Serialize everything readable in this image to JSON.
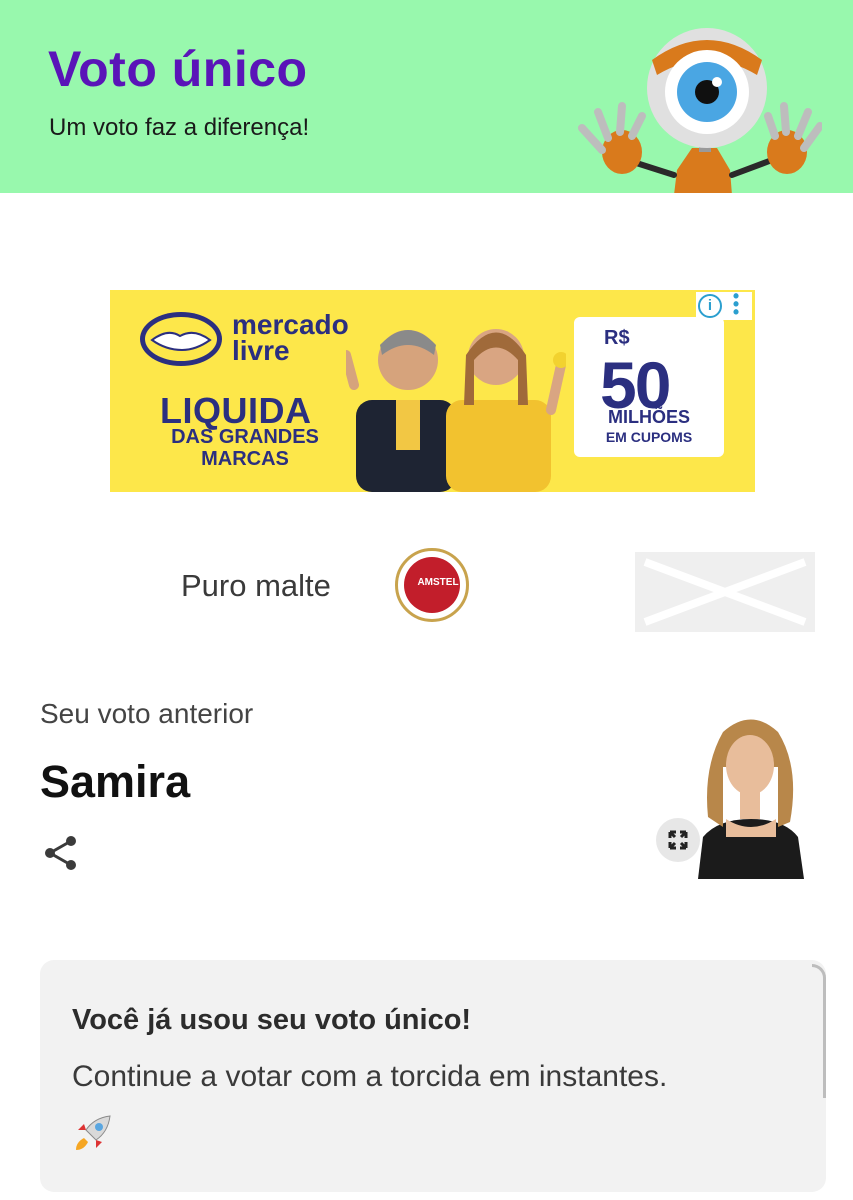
{
  "header": {
    "title": "Voto único",
    "subtitle": "Um voto faz a diferença!"
  },
  "ad": {
    "brand": "mercado livre",
    "headline": "LIQUIDA",
    "subheadline": "DAS GRANDES MARCAS",
    "currency": "R$",
    "amount": "50",
    "unit": "MILHÕES",
    "caption": "EM CUPOMS"
  },
  "sponsor": {
    "text": "Puro malte",
    "logo_text": "AMSTEL"
  },
  "previous_vote": {
    "label": "Seu voto anterior",
    "name": "Samira"
  },
  "notice": {
    "title": "Você já usou seu voto único!",
    "body": "Continue a votar com a torcida em instantes.",
    "emoji": "rocket-icon"
  },
  "colors": {
    "header_bg": "#98f8ad",
    "title": "#5a14b8",
    "ad_bg": "#fde74a",
    "ad_text": "#2b2f80"
  }
}
